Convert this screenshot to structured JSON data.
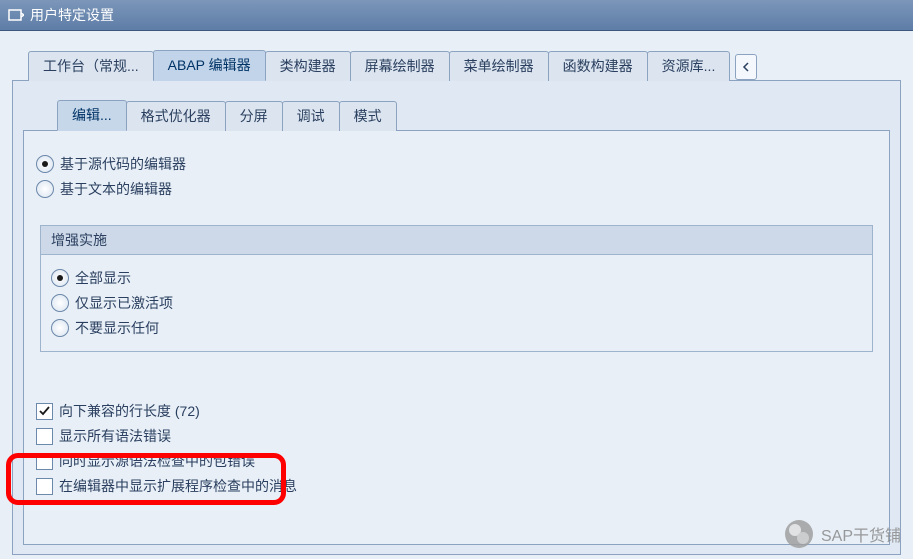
{
  "window": {
    "title": "用户特定设置"
  },
  "top_tabs": [
    {
      "label": "工作台（常规...",
      "active": false
    },
    {
      "label": "ABAP 编辑器",
      "active": true
    },
    {
      "label": "类构建器",
      "active": false
    },
    {
      "label": "屏幕绘制器",
      "active": false
    },
    {
      "label": "菜单绘制器",
      "active": false
    },
    {
      "label": "函数构建器",
      "active": false
    },
    {
      "label": "资源库...",
      "active": false
    }
  ],
  "sub_tabs": [
    {
      "label": "编辑...",
      "active": true
    },
    {
      "label": "格式优化器",
      "active": false
    },
    {
      "label": "分屏",
      "active": false
    },
    {
      "label": "调试",
      "active": false
    },
    {
      "label": "模式",
      "active": false
    }
  ],
  "editor_type_radios": [
    {
      "label": "基于源代码的编辑器",
      "checked": true
    },
    {
      "label": "基于文本的编辑器",
      "checked": false
    }
  ],
  "enhancement_group": {
    "title": "增强实施",
    "options": [
      {
        "label": "全部显示",
        "checked": true
      },
      {
        "label": "仅显示已激活项",
        "checked": false
      },
      {
        "label": "不要显示任何",
        "checked": false
      }
    ]
  },
  "checkboxes": [
    {
      "label": "向下兼容的行长度 (72)",
      "checked": true
    },
    {
      "label": "显示所有语法错误",
      "checked": false
    },
    {
      "label": "同时显示源语法检查中的包错误",
      "checked": false
    },
    {
      "label": "在编辑器中显示扩展程序检查中的消息",
      "checked": false
    }
  ],
  "watermark": {
    "text": "SAP干货铺"
  }
}
